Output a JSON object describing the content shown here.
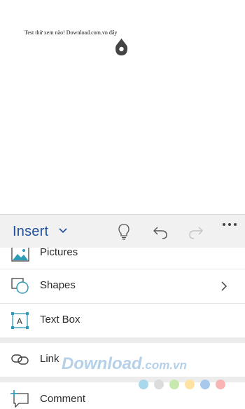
{
  "document": {
    "text": "Test thử xem nào! Download.com.vn đây"
  },
  "toolbar": {
    "tab_label": "Insert",
    "icons": {
      "tab_dropdown": "chevron-down-icon",
      "ideas": "lightbulb-icon",
      "undo": "undo-icon",
      "redo": "redo-icon",
      "more": "more-icon"
    },
    "accent_color": "#1f4e9c",
    "redo_enabled": false
  },
  "menu": {
    "items": [
      {
        "label": "Pictures",
        "icon": "pictures-icon"
      },
      {
        "label": "Shapes",
        "icon": "shapes-icon",
        "has_submenu": true
      },
      {
        "label": "Text Box",
        "icon": "text-box-icon"
      },
      {
        "label": "Link",
        "icon": "link-icon"
      },
      {
        "label": "Comment",
        "icon": "comment-icon"
      }
    ],
    "icon_accent_color": "#2e9bb7"
  },
  "watermark": {
    "text_main": "Download",
    "text_suffix": ".com.vn",
    "dot_colors": [
      "#a8d8ea",
      "#dcdcdc",
      "#c7e9b0",
      "#ffe3a3",
      "#a9c9ec",
      "#f7b5b5"
    ]
  }
}
